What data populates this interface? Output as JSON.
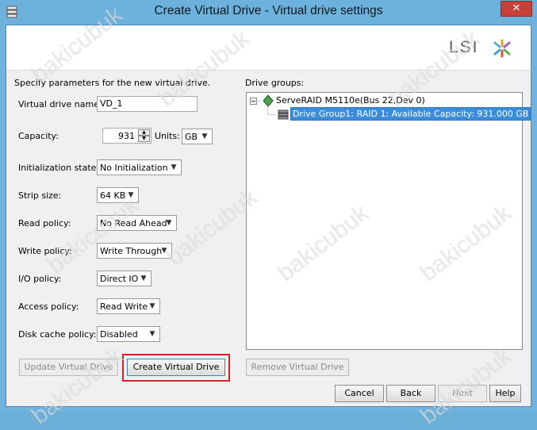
{
  "window": {
    "title": "Create Virtual Drive - Virtual drive settings",
    "close_label": "✕"
  },
  "logo": {
    "text": "LSI"
  },
  "left": {
    "intro": "Specify parameters for the new virtual drive.",
    "vd_name_label": "Virtual drive name:",
    "vd_name_value": "VD_1",
    "capacity_label": "Capacity:",
    "capacity_value": "931",
    "units_label": "Units:",
    "units_value": "GB",
    "init_label": "Initialization state:",
    "init_value": "No Initialization",
    "strip_label": "Strip size:",
    "strip_value": "64 KB",
    "read_label": "Read policy:",
    "read_value": "No Read Ahead",
    "write_label": "Write policy:",
    "write_value": "Write Through",
    "io_label": "I/O policy:",
    "io_value": "Direct IO",
    "access_label": "Access policy:",
    "access_value": "Read Write",
    "cache_label": "Disk cache policy:",
    "cache_value": "Disabled",
    "update_button": "Update Virtual Drive",
    "create_button": "Create Virtual Drive"
  },
  "right": {
    "drive_groups_label": "Drive groups:",
    "controller_node": "ServeRAID M5110e(Bus 22,Dev 0)",
    "drive_group_node": "Drive Group1: RAID 1: Available Capacity: 931.000 GB",
    "remove_button": "Remove Virtual Drive"
  },
  "footer": {
    "cancel": "Cancel",
    "back": "Back",
    "next": "Next",
    "help": "Help"
  },
  "watermark": "bakicubuk"
}
